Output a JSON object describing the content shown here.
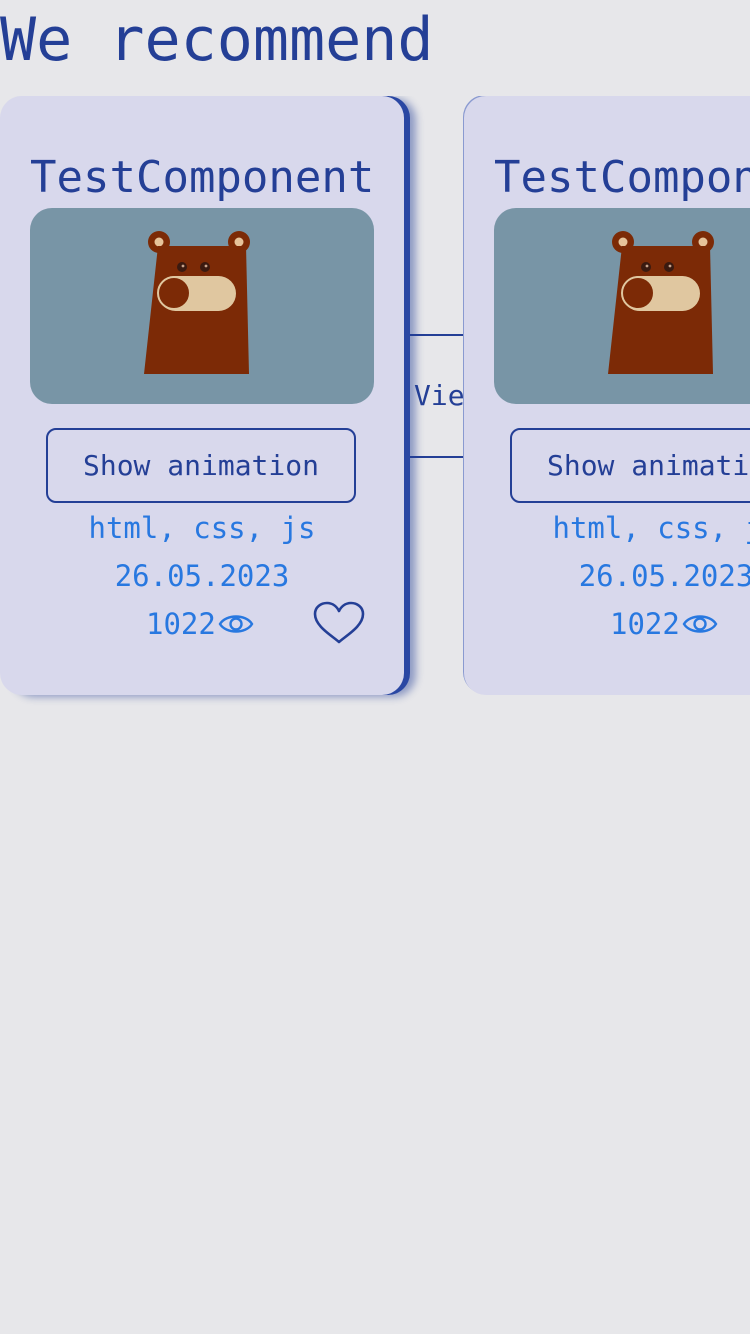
{
  "section": {
    "title": "We recommend"
  },
  "cards": [
    {
      "title": "TestComponent",
      "button_label": "Show animation",
      "tags": "html, css, js",
      "date": "26.05.2023",
      "views": "1022"
    },
    {
      "title": "TestComponent",
      "button_label": "Show animation",
      "tags": "html, css, js",
      "date": "26.05.2023",
      "views": "1022"
    }
  ],
  "view_button": {
    "label": "View"
  },
  "icons": {
    "views": "eye-icon",
    "like": "heart-icon"
  },
  "colors": {
    "background": "#e7e7ea",
    "card": "#d8d8ec",
    "primary": "#243f96",
    "accent": "#2878e0",
    "thumbnail": "#7895a6"
  }
}
